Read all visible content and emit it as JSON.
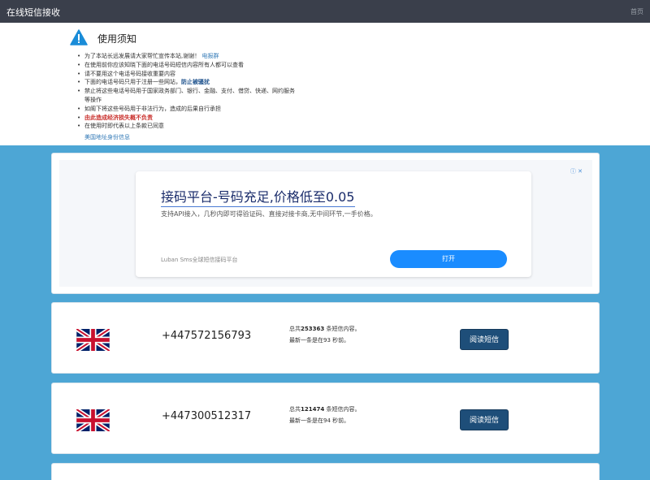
{
  "navbar": {
    "brand": "在线短信接收",
    "home": "首页"
  },
  "notice": {
    "title": "使用须知",
    "items": [
      {
        "text": "为了本站长远发展请大家帮忙宣传本站,谢谢！",
        "link": "电报群"
      },
      {
        "text": "在使用前你应该知晓下面的电话号码短信内容所有人都可以查看"
      },
      {
        "text": "请不要用这个电话号码接收重要内容"
      },
      {
        "text": "下面的电话号码只用于注册一些网站，",
        "emph": "防止被骚扰"
      },
      {
        "text": "禁止将这些电话号码用于国家政务部门、银行、金融、支付、借贷、快递、网约服务",
        "cont": "等操作"
      },
      {
        "text": "如阁下将这些号码用于非法行为，造成的后果自行承担"
      },
      {
        "alert": "由此造成经济损失概不负责"
      },
      {
        "text": "在使用时即代表以上条款已同意"
      }
    ],
    "extra_link": "美国地址身份信息"
  },
  "ad": {
    "title": "接码平台-号码充足,价格低至0.05",
    "desc": "支持API接入，几秒内即可得验证码、直接对接卡商,无中间环节,一手价格。",
    "brand": "Luban Sms全球短信接码平台",
    "button": "打开",
    "choices": "ⓘ ✕"
  },
  "phones": [
    {
      "number": "+447572156793",
      "prefix": "总共",
      "count": "253363",
      "suffix": "条短信内容。",
      "latest_prefix": "最新一条是在",
      "latest": "93",
      "latest_suffix": "秒前。",
      "button": "阅读短信"
    },
    {
      "number": "+447300512317",
      "prefix": "总共",
      "count": "121474",
      "suffix": "条短信内容。",
      "latest_prefix": "最新一条是在",
      "latest": "94",
      "latest_suffix": "秒前。",
      "button": "阅读短信"
    }
  ],
  "icons": {
    "warning": "warning-triangle-icon",
    "flag": "uk-flag-icon"
  },
  "colors": {
    "navbar": "#3a3f4b",
    "page_bg": "#4da6d5",
    "button": "#1e4e79",
    "ad_button": "#1a8cff",
    "alert": "#c9302c"
  }
}
